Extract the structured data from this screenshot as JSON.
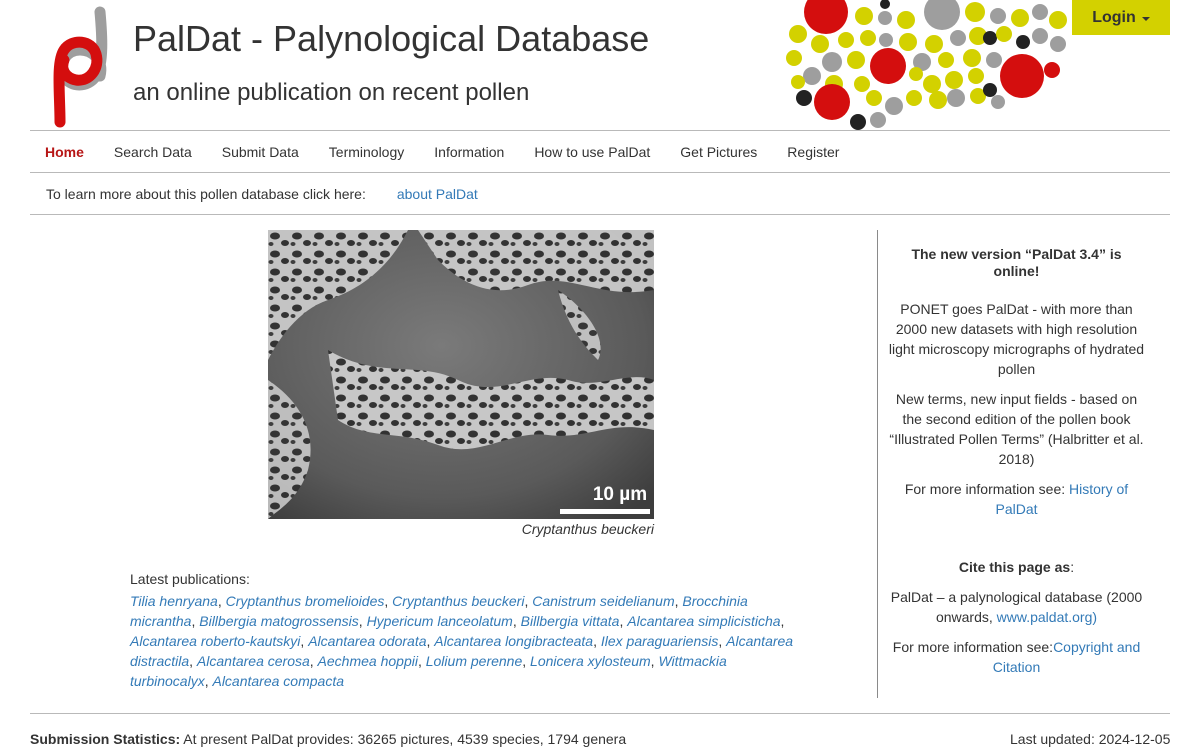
{
  "header": {
    "title": "PalDat - Palynological Database",
    "subtitle": "an online publication on recent pollen",
    "login_label": "Login",
    "colors": {
      "red": "#d40e0e",
      "yellow": "#d3d100",
      "gray": "#9e9e9e",
      "dark": "#222222"
    }
  },
  "nav": {
    "items": [
      {
        "label": "Home",
        "active": true
      },
      {
        "label": "Search Data"
      },
      {
        "label": "Submit Data"
      },
      {
        "label": "Terminology"
      },
      {
        "label": "Information"
      },
      {
        "label": "How to use PalDat"
      },
      {
        "label": "Get Pictures"
      },
      {
        "label": "Register"
      }
    ],
    "active_color": "#b71616"
  },
  "info_bar": {
    "text": "To learn more about this pollen database click here:",
    "link": "about PalDat"
  },
  "hero": {
    "scale_label": "10 µm",
    "caption": "Cryptanthus beuckeri"
  },
  "publications": {
    "label": "Latest publications:",
    "items": [
      "Tilia henryana",
      "Cryptanthus bromelioides",
      "Cryptanthus beuckeri",
      "Canistrum seidelianum",
      "Brocchinia micrantha",
      "Billbergia matogrossensis",
      "Hypericum lanceolatum",
      "Billbergia vittata",
      "Alcantarea simplicisticha",
      "Alcantarea roberto-kautskyi",
      "Alcantarea odorata",
      "Alcantarea longibracteata",
      "Ilex paraguariensis",
      "Alcantarea distractila",
      "Alcantarea cerosa",
      "Aechmea hoppii",
      "Lolium perenne",
      "Lonicera xylosteum",
      "Wittmackia turbinocalyx",
      "Alcantarea compacta"
    ]
  },
  "sidebar": {
    "headline": "The new version “PalDat 3.4” is online!",
    "p1": "PONET goes PalDat - with more than 2000 new datasets with high resolution light microscopy micrographs of hydrated pollen",
    "p2": "New terms, new input fields - based on the second edition of the pollen book “Illustrated Pollen Terms” (Halbritter et al. 2018)",
    "more_info_text": "For more information see:",
    "history_link": "History of PalDat",
    "cite_head": "Cite this page as",
    "cite_colon": ":",
    "cite_text": "PalDat – a palynological database (2000 onwards,",
    "cite_link": "www.paldat.org)",
    "more_info_text2": "For more information see:",
    "copyright_link": "Copyright and Citation"
  },
  "footer": {
    "stats_label": "Submission Statistics:",
    "stats_text": "At present PalDat provides: 36265 pictures, 4539 species, 1794 genera",
    "updated": "Last updated: 2024-12-05"
  }
}
